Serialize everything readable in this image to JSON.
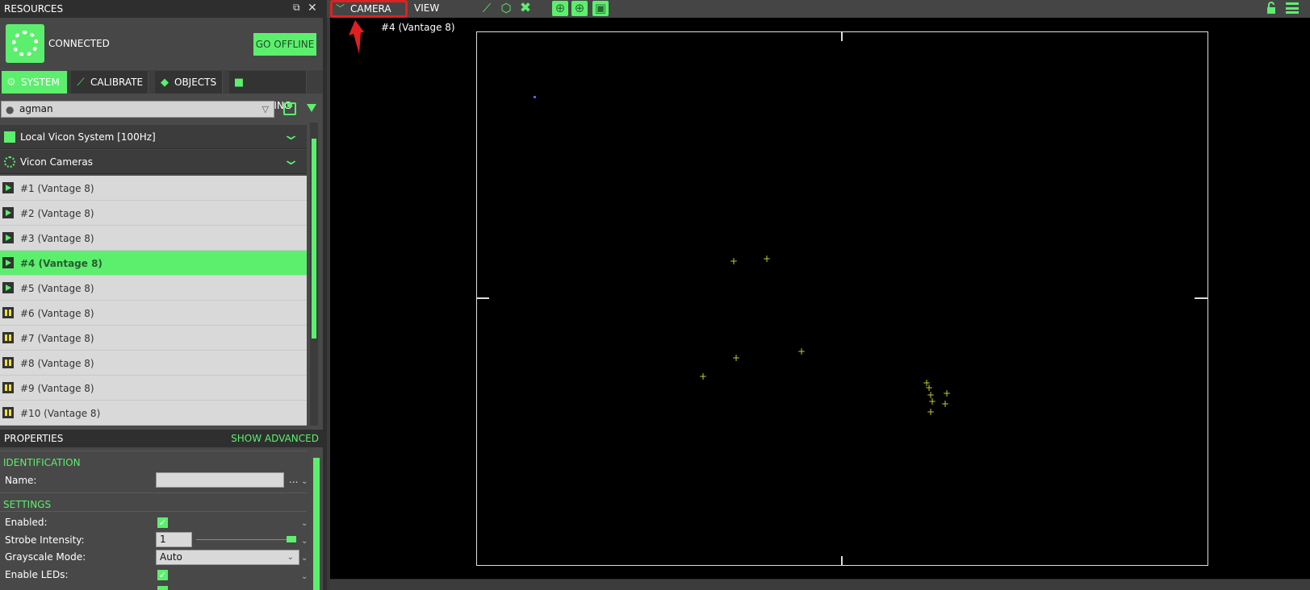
{
  "resources": {
    "title": "RESOURCES",
    "status": "CONNECTED",
    "go_offline": "GO OFFLINE"
  },
  "tabs": [
    {
      "label": "SYSTEM",
      "icon": "gear-icon",
      "active": true
    },
    {
      "label": "CALIBRATE",
      "icon": "wand-icon",
      "active": false
    },
    {
      "label": "OBJECTS",
      "icon": "diamond-icon",
      "active": false
    },
    {
      "label": "RECORDING",
      "icon": "video-camera-icon",
      "active": false
    }
  ],
  "user": {
    "selected": "agman"
  },
  "system_tree": {
    "local_system": "Local Vicon System [100Hz]",
    "cameras_group": "Vicon Cameras",
    "cameras": [
      {
        "label": "#1 (Vantage 8)",
        "state": "play"
      },
      {
        "label": "#2 (Vantage 8)",
        "state": "play"
      },
      {
        "label": "#3 (Vantage 8)",
        "state": "play"
      },
      {
        "label": "#4 (Vantage 8)",
        "state": "play",
        "selected": true
      },
      {
        "label": "#5 (Vantage 8)",
        "state": "play"
      },
      {
        "label": "#6 (Vantage 8)",
        "state": "pause"
      },
      {
        "label": "#7 (Vantage 8)",
        "state": "pause"
      },
      {
        "label": "#8 (Vantage 8)",
        "state": "pause"
      },
      {
        "label": "#9 (Vantage 8)",
        "state": "pause"
      },
      {
        "label": "#10 (Vantage 8)",
        "state": "pause"
      }
    ]
  },
  "properties": {
    "title": "PROPERTIES",
    "show_advanced": "SHOW ADVANCED",
    "identification": "IDENTIFICATION",
    "name_label": "Name:",
    "name_value": "",
    "ellipsis": "...",
    "settings": "SETTINGS",
    "enabled_label": "Enabled:",
    "enabled": true,
    "strobe_label": "Strobe Intensity:",
    "strobe_value": "1",
    "strobe_level": 1.0,
    "grayscale_label": "Grayscale Mode:",
    "grayscale_value": "Auto",
    "leds_label": "Enable LEDs:",
    "leds": true
  },
  "viewport": {
    "camera_menu": "CAMERA",
    "view_menu": "VIEW",
    "camera_label": "#4 (Vantage 8)"
  },
  "colors": {
    "accent": "#5cef6e",
    "marker": "#c8c833",
    "annotation": "#e02020"
  }
}
